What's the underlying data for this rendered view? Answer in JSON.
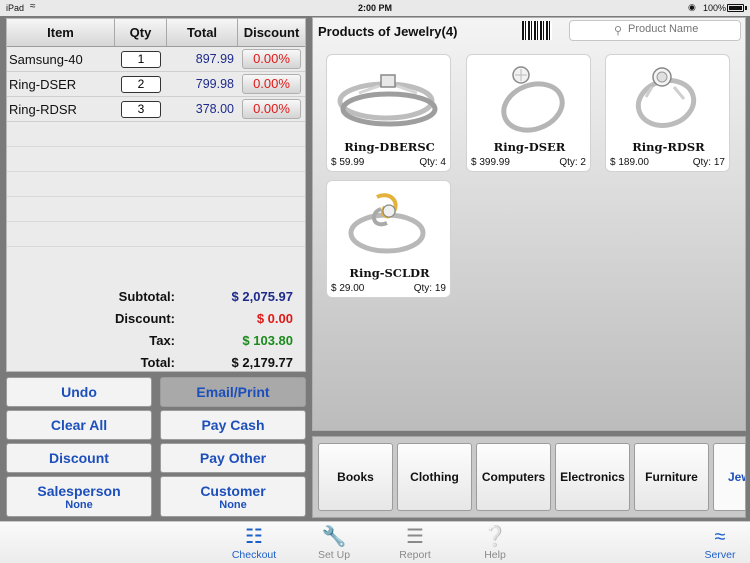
{
  "status": {
    "carrier": "iPad",
    "time": "2:00 PM",
    "battery": "100%"
  },
  "order": {
    "headers": {
      "item": "Item",
      "qty": "Qty",
      "total": "Total",
      "discount": "Discount"
    },
    "rows": [
      {
        "item": "Samsung-40",
        "qty": "1",
        "total": "897.99",
        "discount": "0.00%"
      },
      {
        "item": "Ring-DSER",
        "qty": "2",
        "total": "799.98",
        "discount": "0.00%"
      },
      {
        "item": "Ring-RDSR",
        "qty": "3",
        "total": "378.00",
        "discount": "0.00%"
      }
    ],
    "totals": {
      "subtotal_label": "Subtotal:",
      "subtotal": "$ 2,075.97",
      "discount_label": "Discount:",
      "discount": "$ 0.00",
      "tax_label": "Tax:",
      "tax": "$ 103.80",
      "total_label": "Total:",
      "total": "$ 2,179.77"
    }
  },
  "actions": {
    "undo": "Undo",
    "email_print": "Email/Print",
    "clear_all": "Clear All",
    "pay_cash": "Pay Cash",
    "discount": "Discount",
    "pay_other": "Pay Other",
    "salesperson": "Salesperson",
    "salesperson_value": "None",
    "customer": "Customer",
    "customer_value": "None"
  },
  "products": {
    "title": "Products of Jewelry(4)",
    "search_placeholder": "Product Name",
    "items": [
      {
        "name": "Ring-DBERSC",
        "price": "$ 59.99",
        "qty": "Qty: 4",
        "image": "ring-band-set"
      },
      {
        "name": "Ring-DSER",
        "price": "$ 399.99",
        "qty": "Qty: 2",
        "image": "ring-solitaire"
      },
      {
        "name": "Ring-RDSR",
        "price": "$ 189.00",
        "qty": "Qty: 17",
        "image": "ring-halo"
      },
      {
        "name": "Ring-SCLDR",
        "price": "$ 29.00",
        "qty": "Qty: 19",
        "image": "ring-twotone"
      }
    ]
  },
  "categories": [
    "Books",
    "Clothing",
    "Computers",
    "Electronics",
    "Furniture",
    "Jew"
  ],
  "tabs": [
    {
      "label": "Checkout",
      "icon": "cart-icon"
    },
    {
      "label": "Set Up",
      "icon": "wrench-icon"
    },
    {
      "label": "Report",
      "icon": "list-icon"
    },
    {
      "label": "Help",
      "icon": "question-icon"
    },
    {
      "label": "Server",
      "icon": "wifi-icon"
    }
  ],
  "colors": {
    "accent": "#1d4fbb",
    "discount_red": "#e01818",
    "tax_green": "#1c8a1c",
    "amount_blue": "#1d2a8a"
  }
}
